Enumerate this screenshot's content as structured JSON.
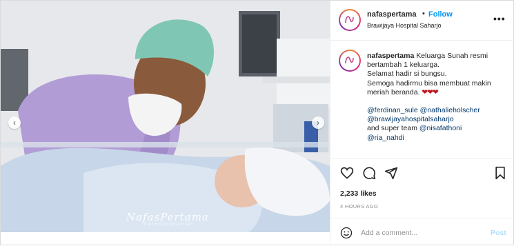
{
  "post": {
    "username": "nafaspertama",
    "dot": "•",
    "follow_label": "Follow",
    "location": "Brawijaya Hospital Saharjo",
    "more_label": "•••",
    "watermark": "NafasPertama",
    "watermark_sub": "BIRTH DOCUMENTARY"
  },
  "caption": {
    "username": "nafaspertama",
    "line1": "Keluarga Sunah resmi",
    "line2": "bertambah 1 keluarga.",
    "line3": "Selamat hadir si bungsu.",
    "line4": "Semoga hadirmu bisa membuat makin",
    "line5": "meriah beranda. ",
    "hearts": "❤❤❤",
    "mentions": [
      "@ferdinan_sule",
      "@nathalieholscher",
      "@brawijayahospitalsaharjo"
    ],
    "and_text": "and super team ",
    "mentions2": [
      "@nisafathoni",
      "@ria_nahdi"
    ]
  },
  "actions": {
    "icons": [
      "heart-icon",
      "comment-icon",
      "share-icon",
      "bookmark-icon"
    ]
  },
  "stats": {
    "likes": "2,233 likes",
    "time": "4 HOURS AGO"
  },
  "comment_box": {
    "placeholder": "Add a comment...",
    "post_label": "Post"
  },
  "colors": {
    "accent": "#0095f6",
    "post_disabled": "#b2dffc",
    "mention": "#00376b",
    "muted": "#8e8e8e"
  }
}
